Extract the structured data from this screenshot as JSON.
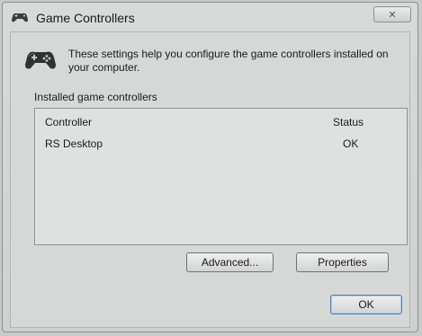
{
  "window": {
    "title": "Game Controllers",
    "close_glyph": "✕"
  },
  "info": {
    "icon": "gamepad-icon",
    "text": "These settings help you configure the game controllers installed on your computer."
  },
  "group": {
    "label": "Installed game controllers"
  },
  "list": {
    "columns": [
      "Controller",
      "Status"
    ],
    "rows": [
      {
        "controller": "RS Desktop",
        "status": "OK"
      }
    ]
  },
  "buttons": {
    "advanced": "Advanced...",
    "properties": "Properties",
    "ok": "OK"
  },
  "colors": {
    "background": "#c9cbca",
    "default_button_border": "#4c7fb0"
  }
}
